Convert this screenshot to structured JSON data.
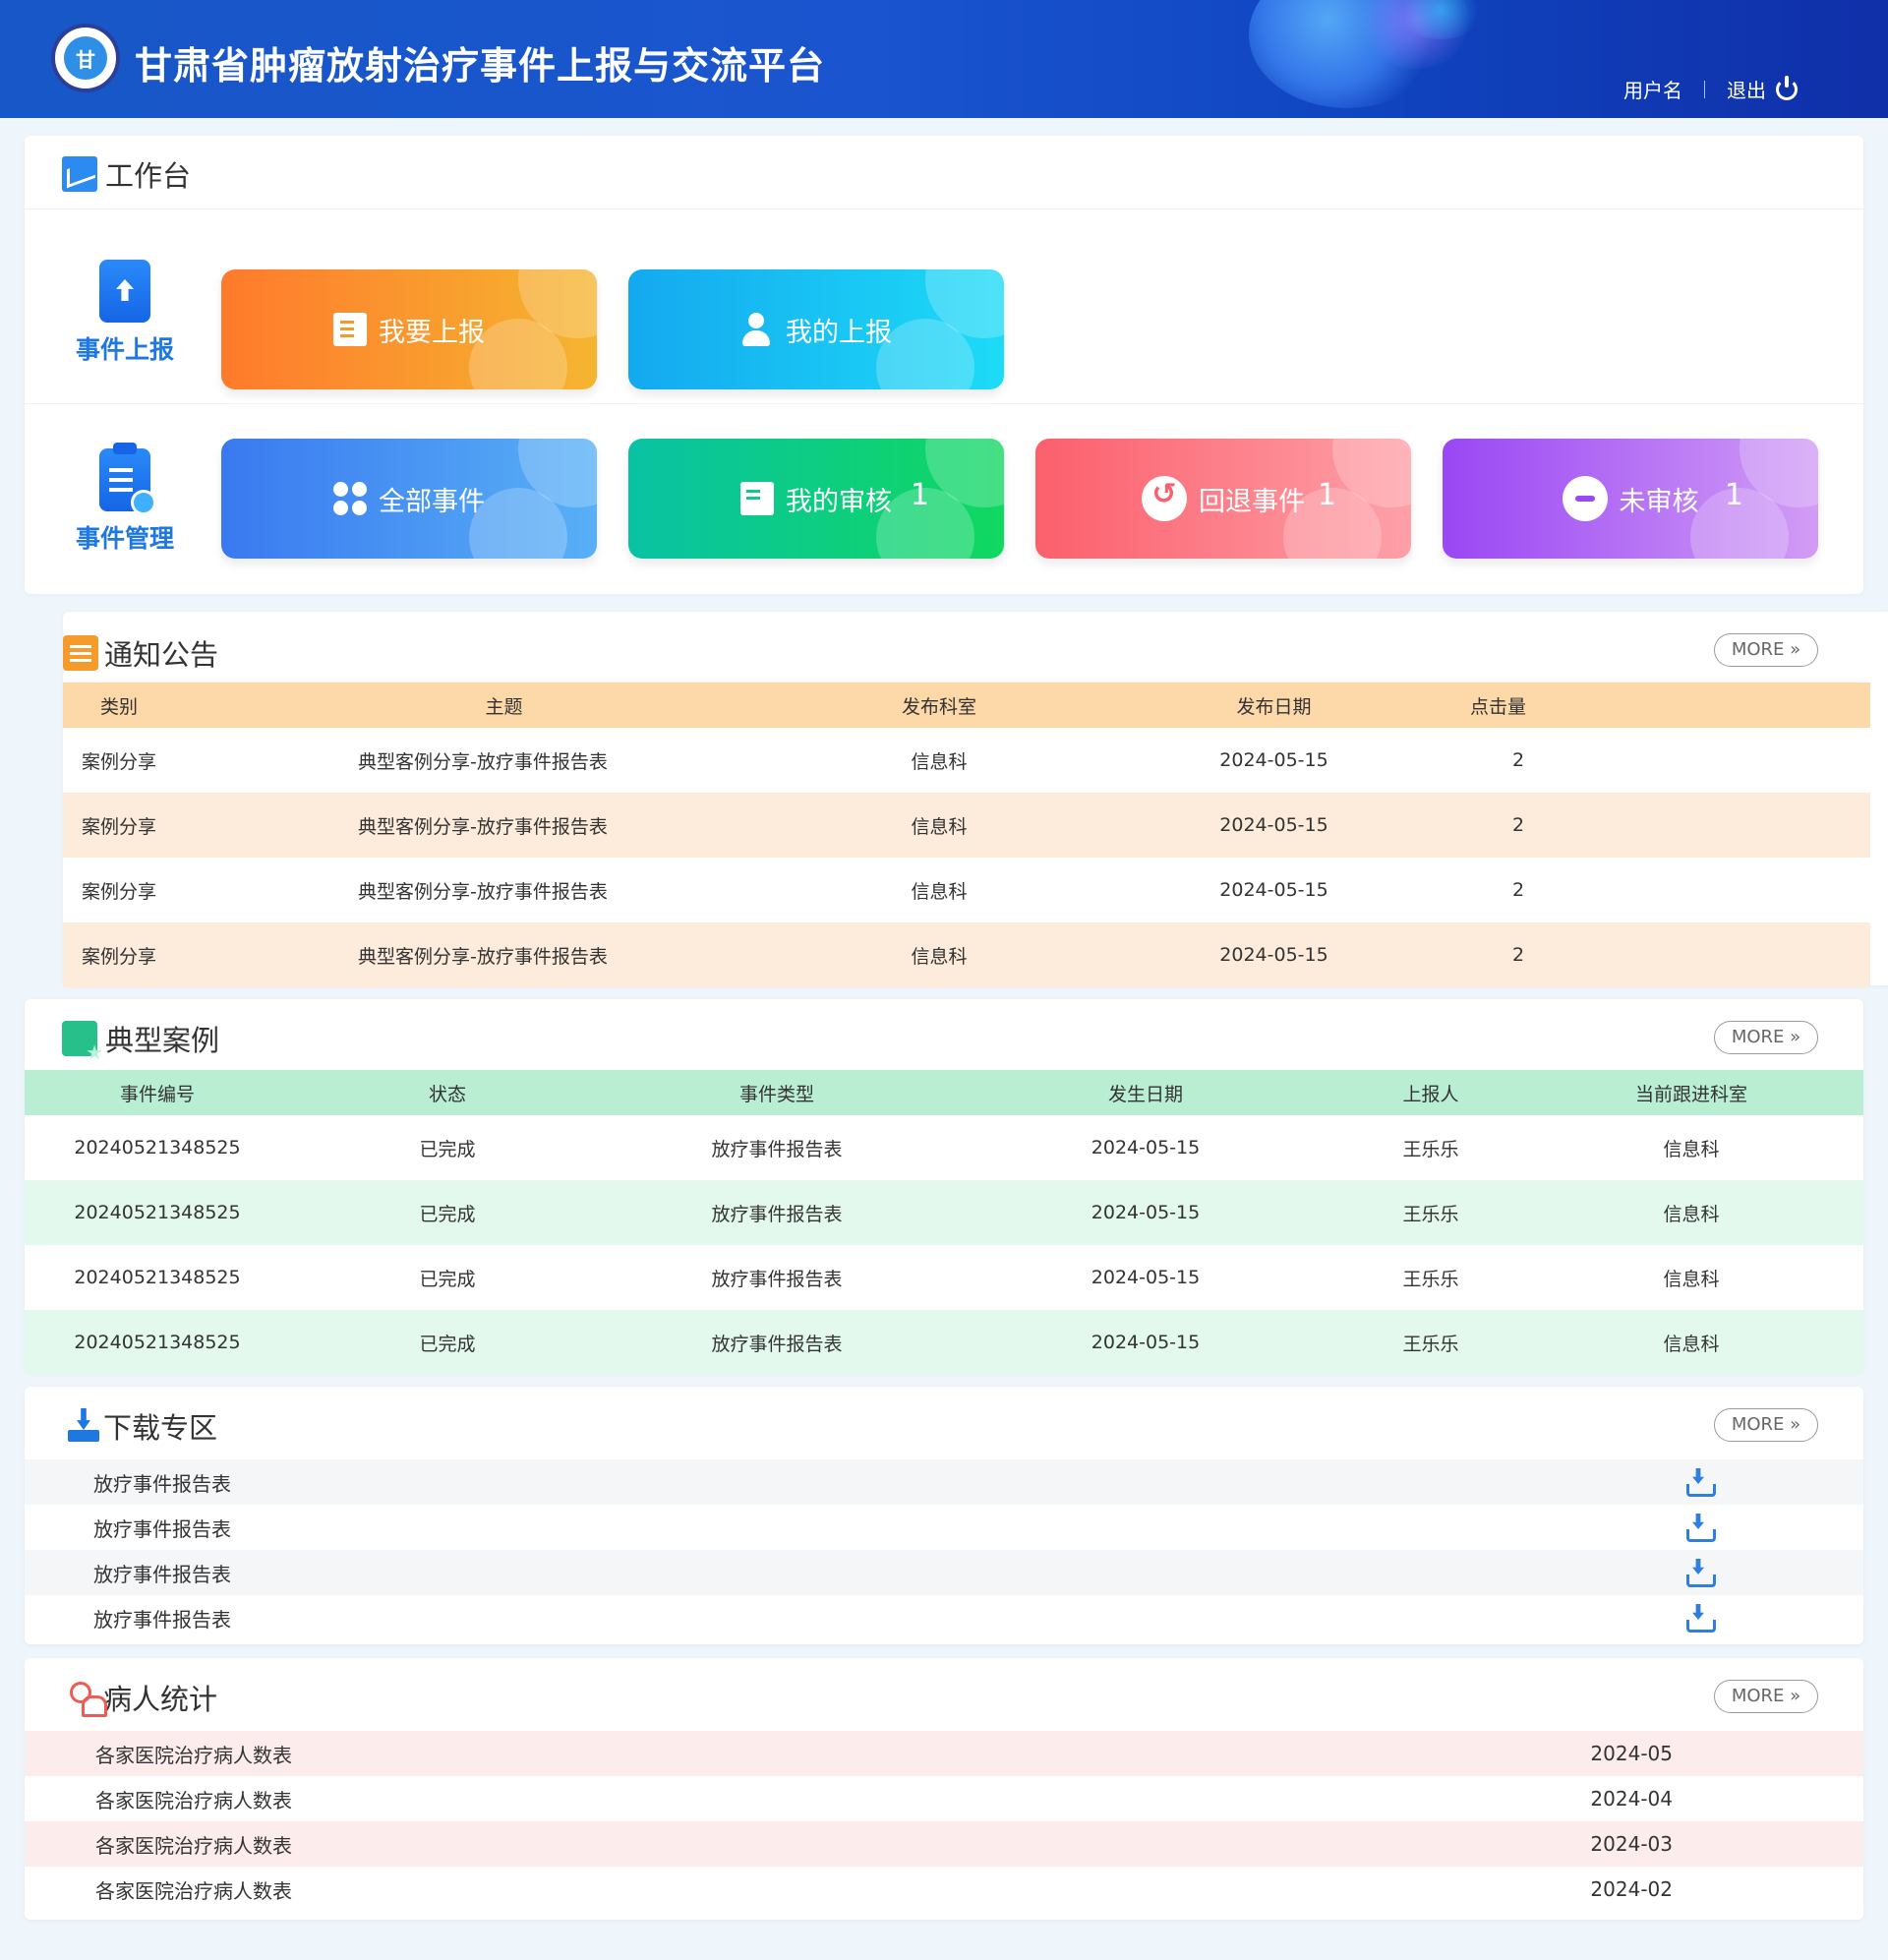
{
  "header": {
    "title": "甘肃省肿瘤放射治疗事件上报与交流平台",
    "logo_text": "甘",
    "username": "用户名",
    "logout": "退出"
  },
  "workbench": {
    "title": "工作台",
    "report_row": {
      "label": "事件上报",
      "tiles": [
        {
          "label": "我要上报",
          "icon": "report-icon",
          "color": "#ff7a2c"
        },
        {
          "label": "我的上报",
          "icon": "user-upload-icon",
          "color": "#14a9ef"
        }
      ]
    },
    "manage_row": {
      "label": "事件管理",
      "tiles": [
        {
          "label": "全部事件",
          "icon": "grid-icon",
          "color": "#3a79f0",
          "count": ""
        },
        {
          "label": "我的审核",
          "icon": "audit-icon",
          "color": "#09c2a4",
          "count": "1"
        },
        {
          "label": "回退事件",
          "icon": "return-icon",
          "color": "#fb5f6c",
          "count": "1"
        },
        {
          "label": "未审核",
          "icon": "minus-circle-icon",
          "color": "#9a47f4",
          "count": "1"
        }
      ]
    }
  },
  "notice": {
    "title": "通知公告",
    "more": "MORE »",
    "columns": [
      "类别",
      "主题",
      "发布科室",
      "发布日期",
      "点击量"
    ],
    "rows": [
      [
        "案例分享",
        "典型客例分享-放疗事件报告表",
        "信息科",
        "2024-05-15",
        "2"
      ],
      [
        "案例分享",
        "典型客例分享-放疗事件报告表",
        "信息科",
        "2024-05-15",
        "2"
      ],
      [
        "案例分享",
        "典型客例分享-放疗事件报告表",
        "信息科",
        "2024-05-15",
        "2"
      ],
      [
        "案例分享",
        "典型客例分享-放疗事件报告表",
        "信息科",
        "2024-05-15",
        "2"
      ]
    ]
  },
  "cases": {
    "title": "典型案例",
    "more": "MORE »",
    "columns": [
      "事件编号",
      "状态",
      "事件类型",
      "发生日期",
      "上报人",
      "当前跟进科室"
    ],
    "rows": [
      [
        "20240521348525",
        "已完成",
        "放疗事件报告表",
        "2024-05-15",
        "王乐乐",
        "信息科"
      ],
      [
        "20240521348525",
        "已完成",
        "放疗事件报告表",
        "2024-05-15",
        "王乐乐",
        "信息科"
      ],
      [
        "20240521348525",
        "已完成",
        "放疗事件报告表",
        "2024-05-15",
        "王乐乐",
        "信息科"
      ],
      [
        "20240521348525",
        "已完成",
        "放疗事件报告表",
        "2024-05-15",
        "王乐乐",
        "信息科"
      ]
    ]
  },
  "downloads": {
    "title": "下载专区",
    "more": "MORE »",
    "items": [
      "放疗事件报告表",
      "放疗事件报告表",
      "放疗事件报告表",
      "放疗事件报告表"
    ]
  },
  "patients": {
    "title": "病人统计",
    "more": "MORE »",
    "items": [
      {
        "name": "各家医院治疗病人数表",
        "date": "2024-05"
      },
      {
        "name": "各家医院治疗病人数表",
        "date": "2024-04"
      },
      {
        "name": "各家医院治疗病人数表",
        "date": "2024-03"
      },
      {
        "name": "各家医院治疗病人数表",
        "date": "2024-02"
      }
    ]
  }
}
